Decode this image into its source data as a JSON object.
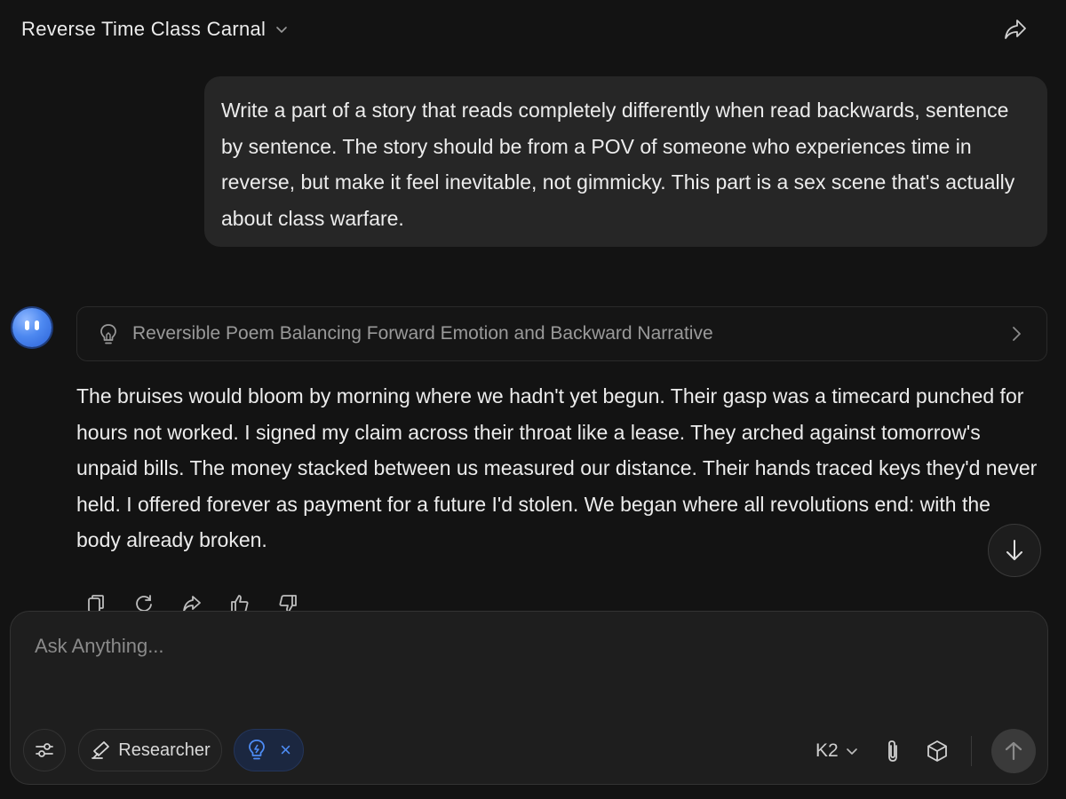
{
  "header": {
    "title": "Reverse Time Class Carnal",
    "title_dropdown_icon": "chevron-down-icon",
    "share_icon": "share-arrow-icon"
  },
  "user_message": {
    "text": "Write a part of a story that reads completely differently when read backwards, sentence by sentence. The story should be from a POV of someone who experiences time in reverse, but make it feel inevitable, not gimmicky. This part is a sex scene that's actually about class warfare."
  },
  "assistant": {
    "avatar_icon": "assistant-face-icon",
    "thinking": {
      "icon": "lightbulb-icon",
      "label": "Reversible Poem Balancing Forward Emotion and Backward Narrative",
      "expand_icon": "chevron-right-icon"
    },
    "reply": "The bruises would bloom by morning where we hadn't yet begun. Their gasp was a timecard punched for hours not worked. I signed my claim across their throat like a lease. They arched against tomorrow's unpaid bills. The money stacked between us measured our distance. Their hands traced keys they'd never held. I offered forever as payment for a future I'd stolen. We began where all revolutions end: with the body already broken.",
    "actions": [
      "copy-icon",
      "regenerate-icon",
      "share-icon",
      "thumbs-up-icon",
      "thumbs-down-icon"
    ]
  },
  "scroll_down_icon": "arrow-down-icon",
  "composer": {
    "placeholder": "Ask Anything...",
    "value": "",
    "settings_icon": "sliders-icon",
    "researcher_label": "Researcher",
    "researcher_icon": "telescope-icon",
    "thinking_toggle_icon": "lightbulb-icon",
    "thinking_toggle_close": "×",
    "model_label": "K2",
    "attach_icon": "paperclip-icon",
    "cube_icon": "cube-icon",
    "send_icon": "arrow-up-icon"
  },
  "colors": {
    "background": "#131313",
    "bubble": "#262626",
    "accent_blue": "#4d88f0"
  }
}
